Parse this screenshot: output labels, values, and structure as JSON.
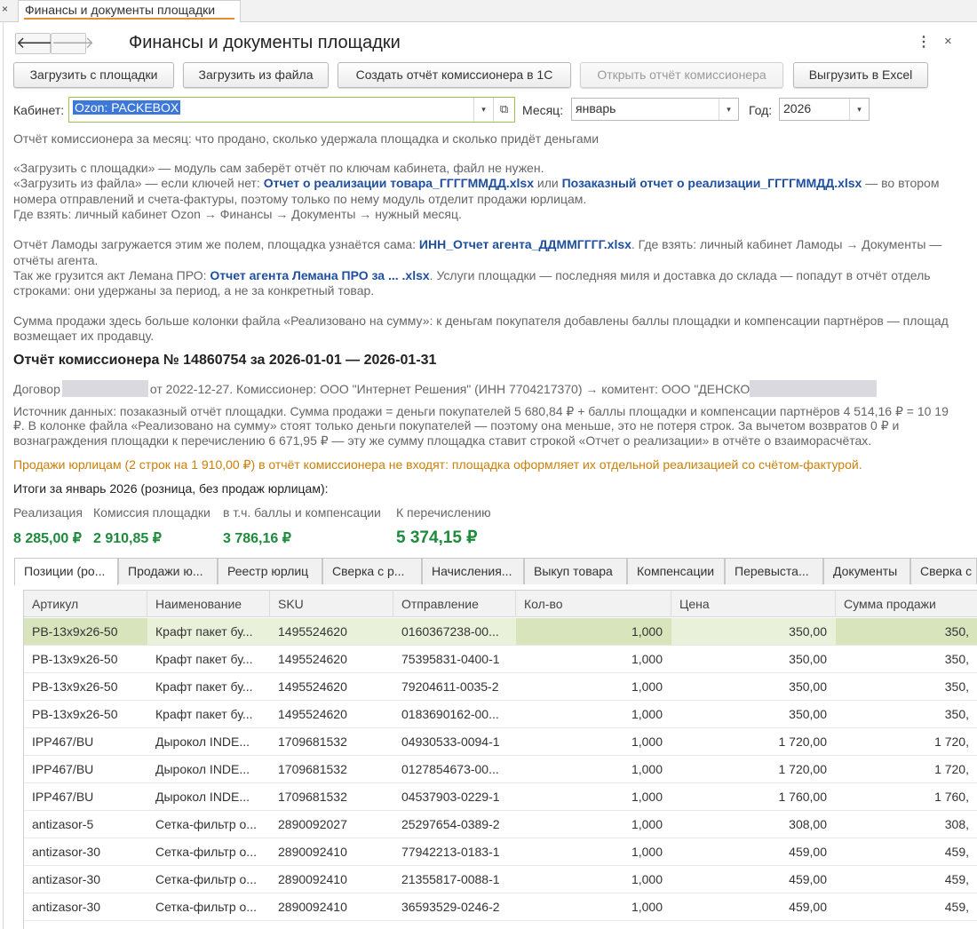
{
  "window_tab": {
    "close_glyph": "×",
    "label": "Финансы и документы площадки"
  },
  "header": {
    "back_glyph": "🡐",
    "forward_glyph": "🡒",
    "title": "Финансы и документы площадки",
    "more_glyph": "⋮",
    "close_glyph": "×"
  },
  "toolbar": {
    "load_platform": "Загрузить с площадки",
    "load_file": "Загрузить из файла",
    "create_report": "Создать отчёт комиссионера в 1С",
    "open_report": "Открыть отчёт комиссионера",
    "export_excel": "Выгрузить в Excel"
  },
  "filters": {
    "cabinet_label": "Кабинет:",
    "cabinet_value": "Ozon: PACKEBOX",
    "month_label": "Месяц:",
    "month_value": "январь",
    "year_label": "Год:",
    "year_value": "2026",
    "dd_glyph": "▾",
    "open_glyph": "⧉"
  },
  "info": {
    "line1": "Отчёт комиссионера за месяц: что продано, сколько удержала площадка и сколько придёт деньгами",
    "line2": "«Загрузить с площадки» — модуль сам заберёт отчёт по ключам кабинета, файл не нужен.",
    "line3_a": "«Загрузить из файла» — если ключей нет: ",
    "line3_link1": "Отчет о реализации товара_ГГГГММДД.xlsx",
    "line3_b": " или ",
    "line3_link2": "Позаказный отчет о реализации_ГГГГММДД.xlsx",
    "line3_c": " — во втором",
    "line4": "номера отправлений и счета-фактуры, поэтому только по нему модуль отделит продажи юрлицам.",
    "line5": "Где взять: личный кабинет Ozon → Финансы → Документы → нужный месяц.",
    "line6_a": "Отчёт Ламоды загружается этим же полем, площадка узнаётся сама: ",
    "line6_link": "ИНН_Отчет агента_ДДММГГГГ.xlsx",
    "line6_b": ". Где взять: личный кабинет Ламоды → Документы —",
    "line7": "отчёты агента.",
    "line8_a": "Так же грузится акт Лемана ПРО: ",
    "line8_link": "Отчет агента Лемана ПРО за ... .xlsx",
    "line8_b": ". Услуги площадки — последняя миля и доставка до склада — попадут в отчёт отдель",
    "line9": "строками: они удержаны за период, а не за конкретный товар.",
    "line10": "Сумма продажи здесь больше колонки файла «Реализовано на сумму»: к деньгам покупателя добавлены баллы площадки и компенсации партнёров — площад",
    "line11": "возмещает их продавцу."
  },
  "report": {
    "title": "Отчёт комиссионера № 14860754 за 2026-01-01 — 2026-01-31",
    "contract_a": "Договор",
    "contract_b": "от 2022-12-27. Комиссионер: ООО \"Интернет Решения\" (ИНН 7704217370) → комитент: ООО \"ДЕНСКО",
    "source1": "Источник данных: позаказный отчёт площадки. Сумма продажи = деньги покупателей 5 680,84 ₽ + баллы площадки и компенсации партнёров 4 514,16 ₽ = 10 19",
    "source2": "₽. В колонке файла «Реализовано на сумму» стоят только деньги покупателей — поэтому она меньше, это не потеря строк. За вычетом возвратов 0 ₽ и",
    "source3": "вознаграждения площадки к перечислению 6 671,95 ₽ — эту же сумму площадка ставит строкой «Отчет о реализации» в отчёте о взаиморасчётах.",
    "legal_note": "Продажи юрлицам (2 строк на 1 910,00 ₽) в отчёт комиссионера не входят: площадка оформляет их отдельной реализацией со счётом-фактурой.",
    "totals_head": "Итоги за январь 2026 (розница, без продаж юрлицам):"
  },
  "summary": [
    {
      "label": "Реализация",
      "value": "8 285,00 ₽"
    },
    {
      "label": "Комиссия площадки",
      "value": "2 910,85 ₽"
    },
    {
      "label": "в т.ч. баллы и компенсации",
      "value": "3 786,16 ₽"
    },
    {
      "label": "К перечислению",
      "value": "5 374,15 ₽"
    }
  ],
  "tabs": [
    "Позиции (ро...",
    "Продажи ю...",
    "Реестр юрлиц",
    "Сверка с р...",
    "Начисления...",
    "Выкуп товара",
    "Компенсации",
    "Перевыста...",
    "Документы",
    "Сверка с"
  ],
  "table": {
    "columns": [
      "Артикул",
      "Наименование",
      "SKU",
      "Отправление",
      "Кол-во",
      "Цена",
      "Сумма продажи"
    ],
    "rows": [
      [
        "PB-13x9x26-50",
        "Крафт пакет бу...",
        "1495524620",
        "0160367238-00...",
        "1,000",
        "350,00",
        "350,"
      ],
      [
        "PB-13x9x26-50",
        "Крафт пакет бу...",
        "1495524620",
        "75395831-0400-1",
        "1,000",
        "350,00",
        "350,"
      ],
      [
        "PB-13x9x26-50",
        "Крафт пакет бу...",
        "1495524620",
        "79204611-0035-2",
        "1,000",
        "350,00",
        "350,"
      ],
      [
        "PB-13x9x26-50",
        "Крафт пакет бу...",
        "1495524620",
        "0183690162-00...",
        "1,000",
        "350,00",
        "350,"
      ],
      [
        "IPP467/BU",
        "Дырокол INDE...",
        "1709681532",
        "04930533-0094-1",
        "1,000",
        "1 720,00",
        "1 720,"
      ],
      [
        "IPP467/BU",
        "Дырокол INDE...",
        "1709681532",
        "0127854673-00...",
        "1,000",
        "1 720,00",
        "1 720,"
      ],
      [
        "IPP467/BU",
        "Дырокол INDE...",
        "1709681532",
        "04537903-0229-1",
        "1,000",
        "1 760,00",
        "1 760,"
      ],
      [
        "antizasor-5",
        "Сетка-фильтр о...",
        "2890092027",
        "25297654-0389-2",
        "1,000",
        "308,00",
        "308,"
      ],
      [
        "antizasor-30",
        "Сетка-фильтр о...",
        "2890092410",
        "77942213-0183-1",
        "1,000",
        "459,00",
        "459,"
      ],
      [
        "antizasor-30",
        "Сетка-фильтр о...",
        "2890092410",
        "21355817-0088-1",
        "1,000",
        "459,00",
        "459,"
      ],
      [
        "antizasor-30",
        "Сетка-фильтр о...",
        "2890092410",
        "36593529-0246-2",
        "1,000",
        "459,00",
        "459,"
      ]
    ]
  }
}
